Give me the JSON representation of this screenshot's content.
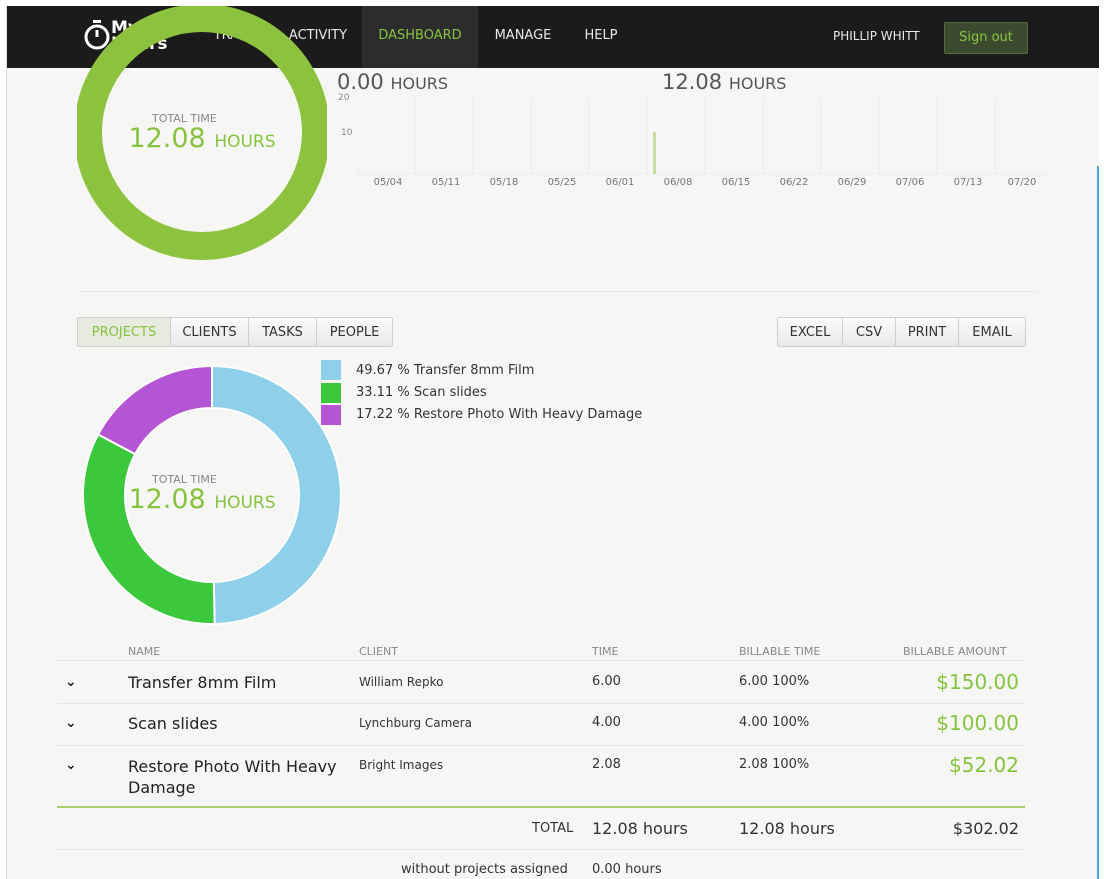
{
  "nav": {
    "logo": {
      "line1": "My",
      "line2": "Hours"
    },
    "items": [
      "TRACK",
      "ACTIVITY",
      "DASHBOARD",
      "MANAGE",
      "HELP"
    ],
    "active": "DASHBOARD",
    "user": "PHILLIP WHITT",
    "signout": "Sign out"
  },
  "summary": {
    "left_value": "0.00",
    "left_unit": "HOURS",
    "right_value": "12.08",
    "right_unit": "HOURS",
    "top_donut": {
      "caption": "TOTAL TIME",
      "value": "12.08",
      "unit": "HOURS"
    }
  },
  "bar_chart": {
    "y_ticks": [
      "20",
      "10"
    ],
    "x_ticks": [
      "05/04",
      "05/11",
      "05/18",
      "05/25",
      "06/01",
      "06/08",
      "06/15",
      "06/22",
      "06/29",
      "07/06",
      "07/13",
      "07/20"
    ]
  },
  "tabs": [
    "PROJECTS",
    "CLIENTS",
    "TASKS",
    "PEOPLE"
  ],
  "active_tab": "PROJECTS",
  "exports": [
    "EXCEL",
    "CSV",
    "PRINT",
    "EMAIL"
  ],
  "project_donut": {
    "caption": "TOTAL TIME",
    "value": "12.08",
    "unit": "HOURS"
  },
  "legend": [
    {
      "text": "49.67 % Transfer 8mm Film",
      "color": "#8ecfea"
    },
    {
      "text": "33.11 % Scan slides",
      "color": "#3cc83c"
    },
    {
      "text": "17.22 % Restore Photo With Heavy Damage",
      "color": "#b654d6"
    }
  ],
  "chart_data": {
    "type": "pie",
    "title": "",
    "categories": [
      "Transfer 8mm Film",
      "Scan slides",
      "Restore Photo With Heavy Damage"
    ],
    "values": [
      49.67,
      33.11,
      17.22
    ],
    "colors": [
      "#8ecfea",
      "#3cc83c",
      "#b654d6"
    ]
  },
  "table": {
    "headers": [
      "NAME",
      "CLIENT",
      "TIME",
      "BILLABLE TIME",
      "BILLABLE AMOUNT"
    ],
    "rows": [
      {
        "name": "Transfer 8mm Film",
        "client": "William Repko",
        "time": "6.00",
        "billable": "6.00",
        "pct": "100%",
        "amount": "$150.00"
      },
      {
        "name": "Scan slides",
        "client": "Lynchburg Camera",
        "time": "4.00",
        "billable": "4.00",
        "pct": "100%",
        "amount": "$100.00"
      },
      {
        "name": "Restore Photo With Heavy",
        "name2": "Damage",
        "client": "Bright Images",
        "time": "2.08",
        "billable": "2.08",
        "pct": "100%",
        "amount": "$52.02"
      }
    ],
    "total_label": "TOTAL",
    "total_time": "12.08 hours",
    "total_billable": "12.08 hours",
    "total_amount": "$302.02",
    "unassigned_label": "without projects assigned",
    "unassigned_time": "0.00 hours"
  }
}
